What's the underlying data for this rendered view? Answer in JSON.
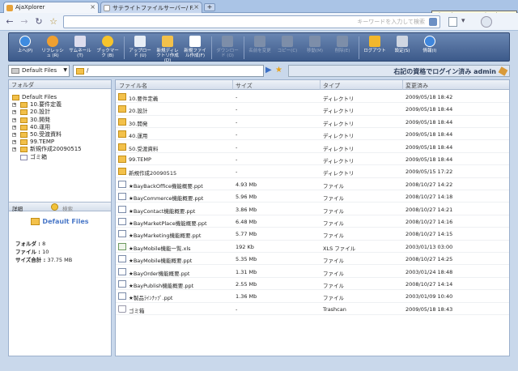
{
  "browser": {
    "tabs": [
      {
        "label": "AjaXplorer",
        "active": true
      },
      {
        "label": "サテライトファイルサーバー/ F.",
        "active": false
      }
    ],
    "new_tab": "+",
    "tooltip": "AjaXplorer - Google Chrome",
    "omnibox_placeholder": "キーワードを入力して検索"
  },
  "toolbar": {
    "buttons": [
      {
        "label": "上へ(P)",
        "icon": "up-arrow-icon",
        "enabled": true
      },
      {
        "label": "リフレッシュ (R)",
        "icon": "refresh-icon",
        "enabled": true
      },
      {
        "label": "サムネール (T)",
        "icon": "thumbnail-icon",
        "enabled": true
      },
      {
        "label": "ブックマーク (B)",
        "icon": "bookmark-star-icon",
        "enabled": true
      },
      {
        "label": "アップロード (U)",
        "icon": "upload-icon",
        "enabled": true
      },
      {
        "label": "新規ディレクトリ作成(D)",
        "icon": "new-folder-icon",
        "enabled": true
      },
      {
        "label": "新規ファイル作成(F)",
        "icon": "new-file-icon",
        "enabled": true
      },
      {
        "label": "ダウンロード (O)",
        "icon": "download-icon",
        "enabled": false
      },
      {
        "label": "名前を変更",
        "icon": "rename-icon",
        "enabled": false
      },
      {
        "label": "コピー(C)",
        "icon": "copy-icon",
        "enabled": false
      },
      {
        "label": "移動(M)",
        "icon": "move-icon",
        "enabled": false
      },
      {
        "label": "削除(E)",
        "icon": "delete-icon",
        "enabled": false
      },
      {
        "label": "ログアウト",
        "icon": "lock-icon",
        "enabled": true
      },
      {
        "label": "設定(S)",
        "icon": "settings-tools-icon",
        "enabled": true
      },
      {
        "label": "情報(I)",
        "icon": "info-icon",
        "enabled": true
      }
    ]
  },
  "location": {
    "drive": "Default Files",
    "path": "/",
    "login_status": "右記の資格でログイン済み admin"
  },
  "folders": {
    "header": "フォルダ",
    "root": "Default Files",
    "items": [
      "10.要件定義",
      "20.設計",
      "30.開発",
      "40.運用",
      "50.受渡資料",
      "99.TEMP",
      "新規作成20090515",
      "ゴミ箱"
    ]
  },
  "info": {
    "tab_info": "詳細",
    "tab_search": "検索",
    "title": "Default Files",
    "folders_label": "フォルダ :",
    "folders_value": "8",
    "files_label": "ファイル :",
    "files_value": "10",
    "total_label": "サイズ合計 :",
    "total_value": "37.75 MB"
  },
  "filelist": {
    "columns": [
      "ファイル名",
      "サイズ",
      "タイプ",
      "変更済み"
    ],
    "rows": [
      {
        "name": "10.要件定義",
        "size": "-",
        "type": "ディレクトリ",
        "modified": "2009/05/18 18:42",
        "icon": "folder"
      },
      {
        "name": "20.設計",
        "size": "-",
        "type": "ディレクトリ",
        "modified": "2009/05/18 18:44",
        "icon": "folder"
      },
      {
        "name": "30.開発",
        "size": "-",
        "type": "ディレクトリ",
        "modified": "2009/05/18 18:44",
        "icon": "folder"
      },
      {
        "name": "40.運用",
        "size": "-",
        "type": "ディレクトリ",
        "modified": "2009/05/18 18:44",
        "icon": "folder"
      },
      {
        "name": "50.受渡資料",
        "size": "-",
        "type": "ディレクトリ",
        "modified": "2009/05/18 18:44",
        "icon": "folder"
      },
      {
        "name": "99.TEMP",
        "size": "-",
        "type": "ディレクトリ",
        "modified": "2009/05/18 18:44",
        "icon": "folder"
      },
      {
        "name": "新規作成20090515",
        "size": "-",
        "type": "ディレクトリ",
        "modified": "2009/05/15 17:22",
        "icon": "folder"
      },
      {
        "name": "★BayBackOffice機能概要.ppt",
        "size": "4.93 Mb",
        "type": "ファイル",
        "modified": "2008/10/27 14:22",
        "icon": "ppt"
      },
      {
        "name": "★BayCommerce機能概要.ppt",
        "size": "5.96 Mb",
        "type": "ファイル",
        "modified": "2008/10/27 14:18",
        "icon": "ppt"
      },
      {
        "name": "★BayContact機能概要.ppt",
        "size": "3.86 Mb",
        "type": "ファイル",
        "modified": "2008/10/27 14:21",
        "icon": "ppt"
      },
      {
        "name": "★BayMarketPlace機能概要.ppt",
        "size": "6.48 Mb",
        "type": "ファイル",
        "modified": "2008/10/27 14:16",
        "icon": "ppt"
      },
      {
        "name": "★BayMarketing機能概要.ppt",
        "size": "5.77 Mb",
        "type": "ファイル",
        "modified": "2008/10/27 14:15",
        "icon": "ppt"
      },
      {
        "name": "★BayMobile機能一覧.xls",
        "size": "192 Kb",
        "type": "XLS ファイル",
        "modified": "2003/01/13 03:00",
        "icon": "xls"
      },
      {
        "name": "★BayMobile機能概要.ppt",
        "size": "5.35 Mb",
        "type": "ファイル",
        "modified": "2008/10/27 14:25",
        "icon": "ppt"
      },
      {
        "name": "★BayOrder機能概要.ppt",
        "size": "1.31 Mb",
        "type": "ファイル",
        "modified": "2003/01/24 18:48",
        "icon": "ppt"
      },
      {
        "name": "★BayPublish機能概要.ppt",
        "size": "2.55 Mb",
        "type": "ファイル",
        "modified": "2008/10/27 14:14",
        "icon": "ppt"
      },
      {
        "name": "★製品ﾗｲﾝﾅｯﾌﾟ.ppt",
        "size": "1.36 Mb",
        "type": "ファイル",
        "modified": "2003/01/09 10:40",
        "icon": "ppt"
      },
      {
        "name": "ゴミ箱",
        "size": "-",
        "type": "Trashcan",
        "modified": "2009/05/18 18:43",
        "icon": "trash"
      }
    ]
  }
}
